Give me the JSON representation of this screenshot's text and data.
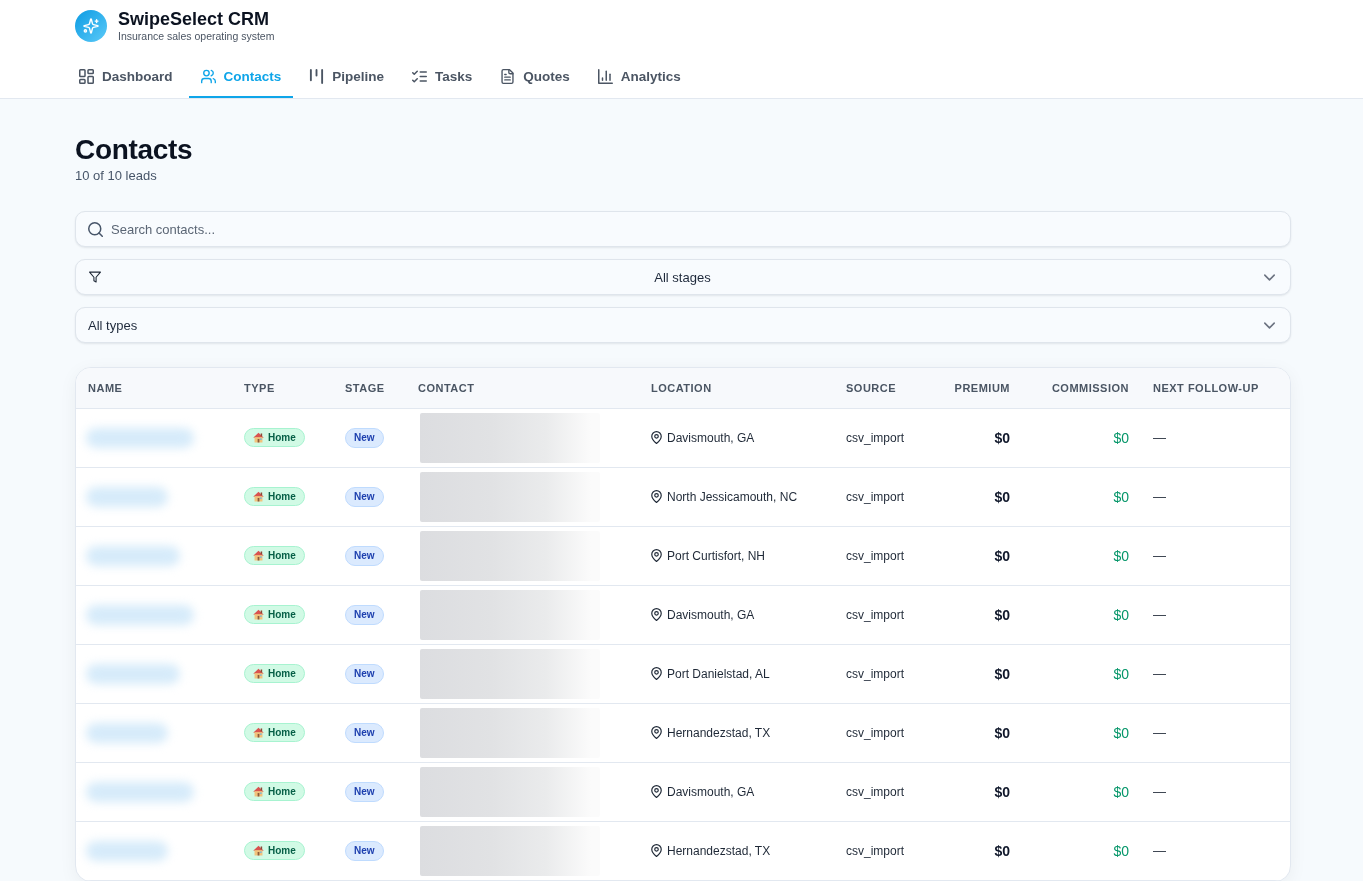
{
  "app": {
    "name": "SwipeSelect CRM",
    "tagline": "Insurance sales operating system"
  },
  "tabs": [
    {
      "label": "Dashboard",
      "selected": false
    },
    {
      "label": "Contacts",
      "selected": true
    },
    {
      "label": "Pipeline",
      "selected": false
    },
    {
      "label": "Tasks",
      "selected": false
    },
    {
      "label": "Quotes",
      "selected": false
    },
    {
      "label": "Analytics",
      "selected": false
    }
  ],
  "page": {
    "title": "Contacts",
    "count": "10 of 10 leads"
  },
  "search": {
    "placeholder": "Search contacts..."
  },
  "filters": [
    {
      "kind": "stage",
      "value": "All stages"
    },
    {
      "kind": "type",
      "value": "All types"
    }
  ],
  "table": {
    "columns": [
      "NAME",
      "TYPE",
      "STAGE",
      "CONTACT",
      "LOCATION",
      "SOURCE",
      "PREMIUM",
      "COMMISSION",
      "NEXT FOLLOW-UP"
    ],
    "rows": [
      {
        "name_blurred": true,
        "type": "Home",
        "stage": "New",
        "contact_blurred": true,
        "location": "Davismouth, GA",
        "source": "csv_import",
        "premium": "$0",
        "commission": "$0",
        "next_follow_up": "—"
      },
      {
        "name_blurred": true,
        "type": "Home",
        "stage": "New",
        "contact_blurred": true,
        "location": "North Jessicamouth, NC",
        "source": "csv_import",
        "premium": "$0",
        "commission": "$0",
        "next_follow_up": "—"
      },
      {
        "name_blurred": true,
        "type": "Home",
        "stage": "New",
        "contact_blurred": true,
        "location": "Port Curtisfort, NH",
        "source": "csv_import",
        "premium": "$0",
        "commission": "$0",
        "next_follow_up": "—"
      },
      {
        "name_blurred": true,
        "type": "Home",
        "stage": "New",
        "contact_blurred": true,
        "location": "Davismouth, GA",
        "source": "csv_import",
        "premium": "$0",
        "commission": "$0",
        "next_follow_up": "—"
      },
      {
        "name_blurred": true,
        "type": "Home",
        "stage": "New",
        "contact_blurred": true,
        "location": "Port Danielstad, AL",
        "source": "csv_import",
        "premium": "$0",
        "commission": "$0",
        "next_follow_up": "—"
      },
      {
        "name_blurred": true,
        "type": "Home",
        "stage": "New",
        "contact_blurred": true,
        "location": "Hernandezstad, TX",
        "source": "csv_import",
        "premium": "$0",
        "commission": "$0",
        "next_follow_up": "—"
      },
      {
        "name_blurred": true,
        "type": "Home",
        "stage": "New",
        "contact_blurred": true,
        "location": "Davismouth, GA",
        "source": "csv_import",
        "premium": "$0",
        "commission": "$0",
        "next_follow_up": "—"
      },
      {
        "name_blurred": true,
        "type": "Home",
        "stage": "New",
        "contact_blurred": true,
        "location": "Hernandezstad, TX",
        "source": "csv_import",
        "premium": "$0",
        "commission": "$0",
        "next_follow_up": "—"
      }
    ]
  }
}
